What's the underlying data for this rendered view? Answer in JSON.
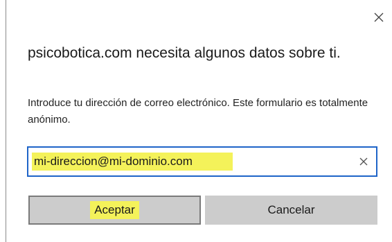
{
  "dialog": {
    "title": "psicobotica.com necesita algunos datos sobre ti.",
    "description": "Introduce tu dirección de correo electrónico. Este formulario es totalmente anónimo.",
    "email_input": {
      "value": "mi-direccion@mi-dominio.com",
      "placeholder": ""
    },
    "accept_label": "Aceptar",
    "cancel_label": "Cancelar",
    "close_icon": "close-icon",
    "clear_icon": "clear-icon"
  },
  "colors": {
    "focus_border": "#1e64c8",
    "highlight": "#f4f25a",
    "button_bg": "#cccccc"
  }
}
